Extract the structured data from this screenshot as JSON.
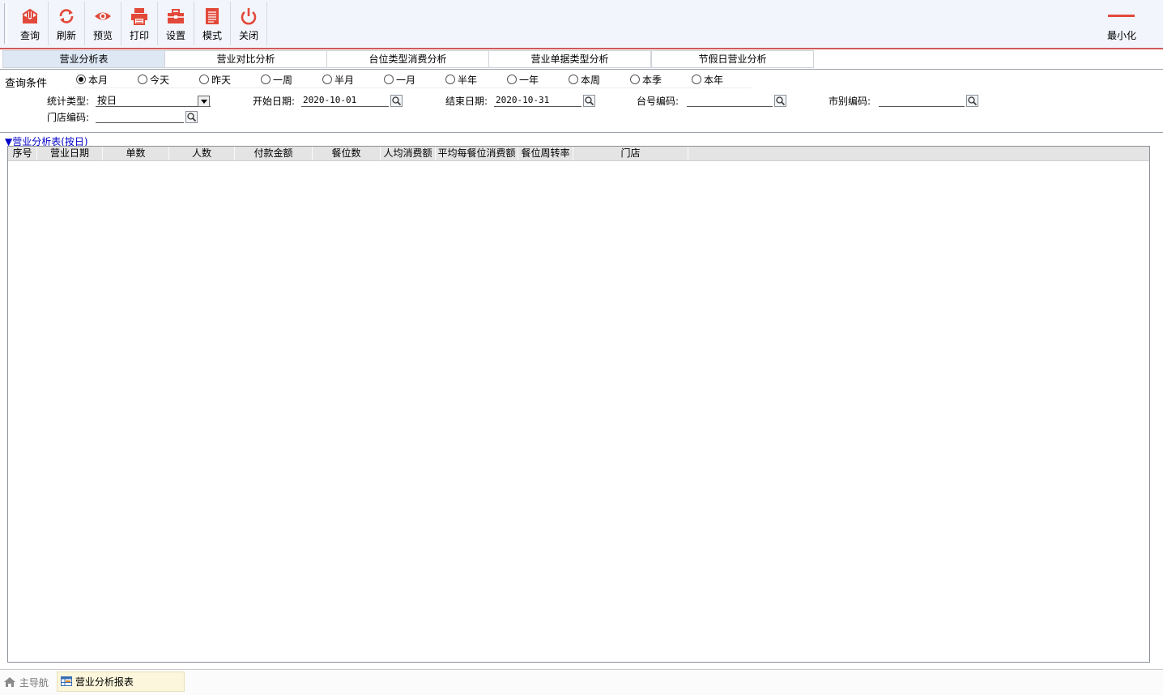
{
  "toolbar": {
    "buttons": [
      {
        "label": "查询",
        "icon": "query-icon"
      },
      {
        "label": "刷新",
        "icon": "refresh-icon"
      },
      {
        "label": "预览",
        "icon": "eye-icon"
      },
      {
        "label": "打印",
        "icon": "printer-icon"
      },
      {
        "label": "设置",
        "icon": "toolbox-icon"
      },
      {
        "label": "模式",
        "icon": "document-icon"
      },
      {
        "label": "关闭",
        "icon": "power-icon"
      }
    ],
    "minimize_label": "最小化",
    "accent_color": "#e2493a"
  },
  "tabs": [
    "营业分析表",
    "营业对比分析",
    "台位类型消费分析",
    "营业单据类型分析",
    "节假日营业分析"
  ],
  "active_tab": "营业分析表",
  "query": {
    "title": "查询条件",
    "periods": [
      "本月",
      "今天",
      "昨天",
      "一周",
      "半月",
      "一月",
      "半年",
      "一年",
      "本周",
      "本季",
      "本年"
    ],
    "selected_period": "本月",
    "stat_type_label": "统计类型:",
    "stat_type_value": "按日",
    "start_date_label": "开始日期:",
    "start_date_value": "2020-10-01",
    "end_date_label": "结束日期:",
    "end_date_value": "2020-10-31",
    "table_code_label": "台号编码:",
    "table_code_value": "",
    "market_code_label": "市别编码:",
    "market_code_value": "",
    "store_code_label": "门店编码:",
    "store_code_value": ""
  },
  "report": {
    "section_title": "▼营业分析表(按日)",
    "columns": [
      "序号",
      "营业日期",
      "单数",
      "人数",
      "付款金额",
      "餐位数",
      "人均消费额",
      "平均每餐位消费额",
      "餐位周转率",
      "门店"
    ],
    "rows": []
  },
  "statusbar": {
    "home_label": "主导航",
    "report_label": "营业分析报表"
  }
}
